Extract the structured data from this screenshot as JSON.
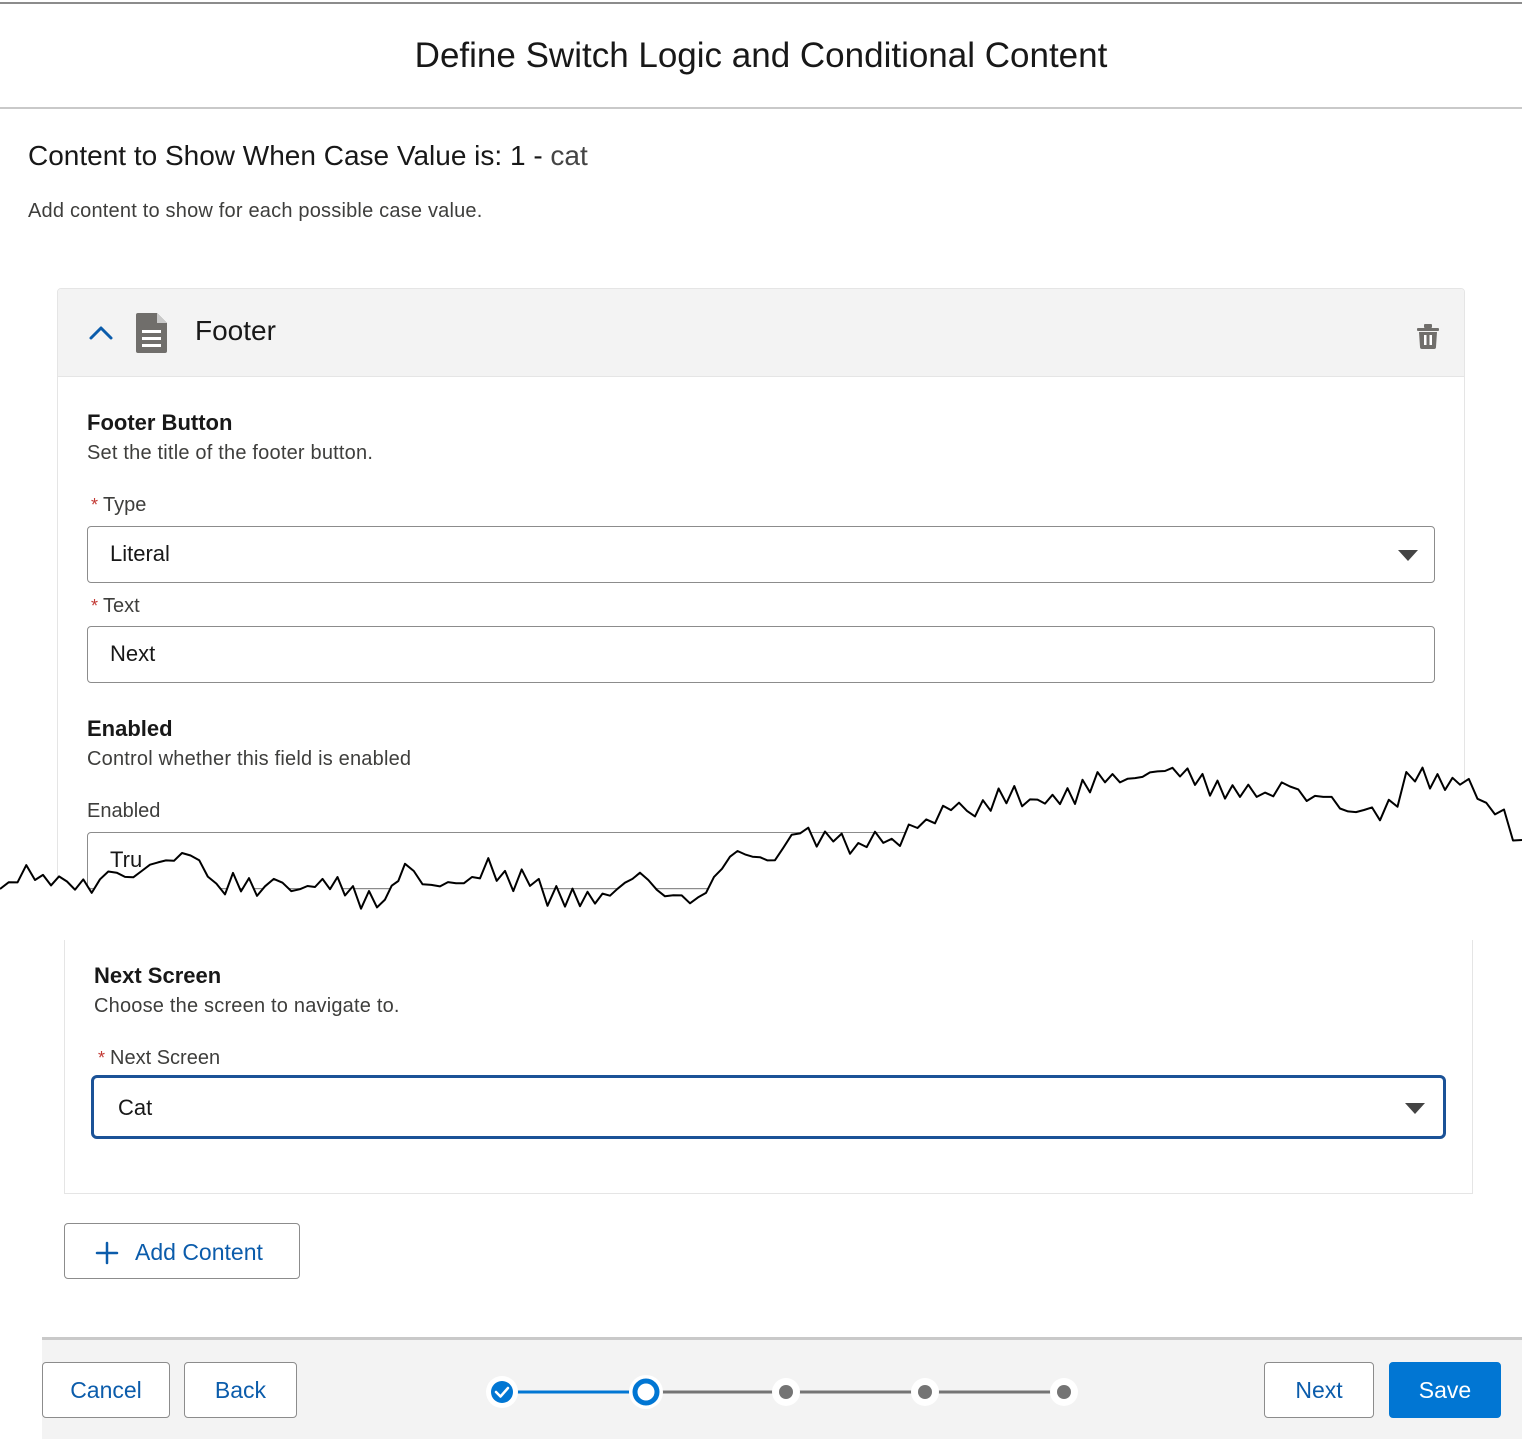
{
  "modal": {
    "title": "Define Switch Logic and Conditional Content"
  },
  "section": {
    "title_prefix": "Content to Show When Case Value is: 1 - ",
    "case_value": "cat",
    "description": "Add content to show for each possible case value."
  },
  "card": {
    "title": "Footer",
    "footer_button": {
      "title": "Footer Button",
      "description": "Set the title of the footer button.",
      "type_label": "Type",
      "type_value": "Literal",
      "text_label": "Text",
      "text_value": "Next"
    },
    "enabled": {
      "title": "Enabled",
      "description": "Control whether this field is enabled",
      "field_label": "Enabled",
      "field_value_visible": "Tru"
    },
    "next_screen": {
      "title": "Next Screen",
      "description": "Choose the screen to navigate to.",
      "field_label": "Next Screen",
      "field_value": "Cat"
    }
  },
  "required_marker": "*",
  "add_content_label": "Add Content",
  "footer": {
    "cancel": "Cancel",
    "back": "Back",
    "next": "Next",
    "save": "Save",
    "progress": {
      "total_steps": 5,
      "completed_steps": 1,
      "current_step": 2
    }
  },
  "colors": {
    "brand": "#0176d3",
    "link": "#0b5cab",
    "focus": "#1b5297",
    "required": "#c23934",
    "header_bg": "#f3f3f3"
  },
  "icons": {
    "collapse": "chevron-up-icon",
    "content_type": "document-icon",
    "delete": "trash-icon",
    "add": "plus-icon",
    "completed_step": "check-icon"
  }
}
